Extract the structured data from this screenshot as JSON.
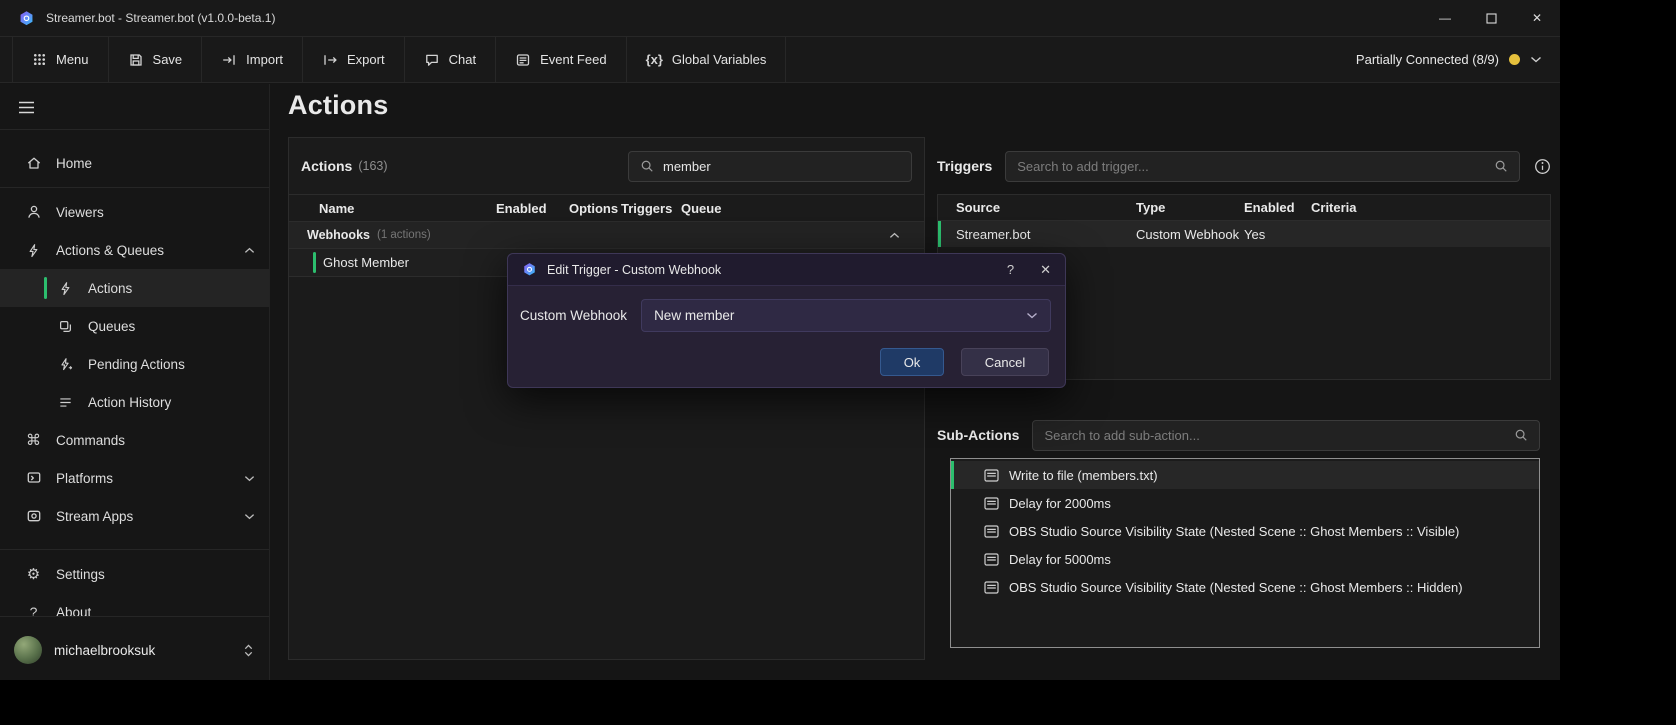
{
  "window": {
    "title": "Streamer.bot - Streamer.bot (v1.0.0-beta.1)"
  },
  "toolbar": {
    "buttons": [
      {
        "label": "Menu"
      },
      {
        "label": "Save"
      },
      {
        "label": "Import"
      },
      {
        "label": "Export"
      },
      {
        "label": "Chat"
      },
      {
        "label": "Event Feed"
      },
      {
        "label": "Global Variables"
      }
    ]
  },
  "connection": {
    "status": "Partially Connected (8/9)"
  },
  "sidebar": {
    "items": [
      {
        "label": "Home",
        "icon": "home-icon"
      },
      {
        "label": "Viewers",
        "icon": "viewers-icon"
      },
      {
        "label": "Actions & Queues",
        "icon": "bolt-icon"
      },
      {
        "label": "Actions",
        "icon": "bolt-icon",
        "selected": true
      },
      {
        "label": "Queues",
        "icon": "queues-icon"
      },
      {
        "label": "Pending Actions",
        "icon": "pending-actions-icon"
      },
      {
        "label": "Action History",
        "icon": "history-icon"
      },
      {
        "label": "Commands",
        "icon": "commands-icon"
      },
      {
        "label": "Platforms",
        "icon": "platforms-icon"
      },
      {
        "label": "Stream Apps",
        "icon": "stream-apps-icon"
      },
      {
        "label": "Settings",
        "icon": "gear-icon"
      },
      {
        "label": "About",
        "icon": "question-icon"
      }
    ],
    "user": {
      "name": "michaelbrooksuk"
    }
  },
  "page": {
    "title": "Actions"
  },
  "actions_panel": {
    "title": "Actions",
    "count": "(163)",
    "search_value": "member",
    "columns": [
      "Name",
      "Enabled",
      "Options",
      "Triggers",
      "Queue"
    ],
    "group": {
      "name": "Webhooks",
      "count": "(1 actions)"
    },
    "rows": [
      {
        "name": "Ghost Member"
      }
    ]
  },
  "triggers_panel": {
    "title": "Triggers",
    "search_placeholder": "Search to add trigger...",
    "columns": [
      "Source",
      "Type",
      "Enabled",
      "Criteria"
    ],
    "rows": [
      {
        "source": "Streamer.bot",
        "type": "Custom Webhook",
        "enabled": "Yes",
        "criteria": ""
      }
    ]
  },
  "subactions_panel": {
    "title": "Sub-Actions",
    "search_placeholder": "Search to add sub-action...",
    "items": [
      "Write to file (members.txt)",
      "Delay for 2000ms",
      "OBS Studio Source Visibility State (Nested Scene :: Ghost Members :: Visible)",
      "Delay for 5000ms",
      "OBS Studio Source Visibility State (Nested Scene :: Ghost Members :: Hidden)"
    ]
  },
  "modal": {
    "title": "Edit Trigger - Custom Webhook",
    "field_label": "Custom Webhook",
    "dropdown_value": "New member",
    "ok_label": "Ok",
    "cancel_label": "Cancel"
  },
  "icons": {
    "minimize": "—",
    "close": "✕",
    "commands": "⌘",
    "settings": "⚙",
    "about": "?",
    "global_variables": "{x}",
    "help": "?"
  },
  "colors": {
    "accent_green": "#2cbe6e",
    "status_yellow": "#e5c03c"
  }
}
